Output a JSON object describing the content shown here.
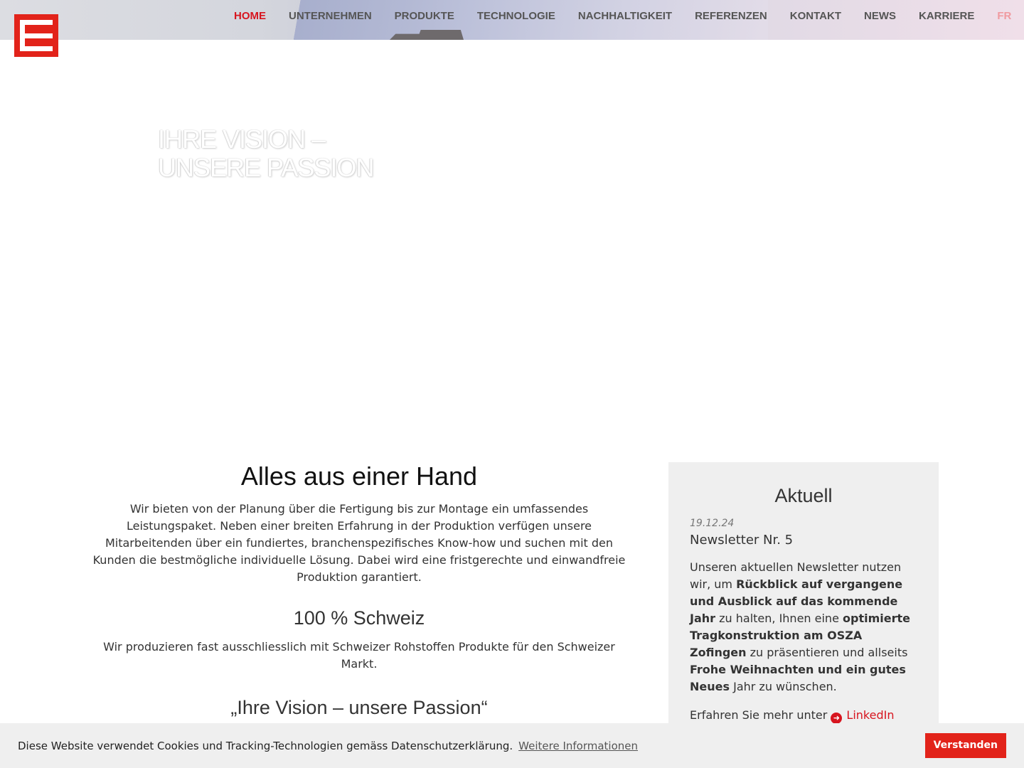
{
  "header": {
    "nav": [
      {
        "label": "HOME"
      },
      {
        "label": "UNTERNEHMEN"
      },
      {
        "label": "PRODUKTE"
      },
      {
        "label": "TECHNOLOGIE"
      },
      {
        "label": "NACHHALTIGKEIT"
      },
      {
        "label": "REFERENZEN"
      },
      {
        "label": "KONTAKT"
      },
      {
        "label": "NEWS"
      },
      {
        "label": "KARRIERE"
      },
      {
        "label": "FR"
      }
    ],
    "active_item": "HOME"
  },
  "hero": {
    "line1": "IHRE VISION –",
    "line2": "UNSERE PASSION"
  },
  "main": {
    "title": "Alles aus einer Hand",
    "intro": "Wir bieten von der Planung über die Fertigung bis zur Montage ein umfassendes Leistungspaket. Neben einer breiten Erfahrung in der Produktion verfügen unsere Mitarbeitenden über ein fundiertes, branchenspezifisches Know-how und suchen mit den Kunden die bestmögliche individuelle Lösung. Dabei wird eine fristgerechte und einwandfreie Produktion garantiert.",
    "schweiz_title": "100 % Schweiz",
    "schweiz_text": "Wir produzieren fast ausschliesslich mit Schweizer Rohstoffen Produkte für den Schweizer Markt.",
    "motto": "„Ihre Vision – unsere Passion“"
  },
  "news": {
    "title": "Aktuell",
    "date": "19.12.24",
    "headline": "Newsletter Nr. 5",
    "body_parts": [
      "Unseren aktuellen Newsletter nutzen wir, um ",
      "Rückblick auf vergangene und Ausblick auf das kommende Jahr",
      " zu halten, Ihnen eine ",
      "optimierte Tragkonstruktion am OSZA Zofingen",
      " zu präsentieren und allseits ",
      "Frohe Weihnachten und ein gutes Neues",
      " Jahr zu wünschen."
    ],
    "more_prefix": "Erfahren Sie mehr unter",
    "more_link": "LinkedIn",
    "more_icon": "arrow-circle-right-icon"
  },
  "cookie": {
    "message": "Diese Website verwendet Cookies und Tracking-Technologien gemäss Datenschutzerklärung.",
    "more_label": "Weitere Informationen",
    "accept_label": "Verstanden"
  },
  "colors": {
    "brand_red": "#e2231a",
    "link_red": "#d7151f",
    "lang_pink": "#f09aa0",
    "panel_gray": "#efefef"
  }
}
